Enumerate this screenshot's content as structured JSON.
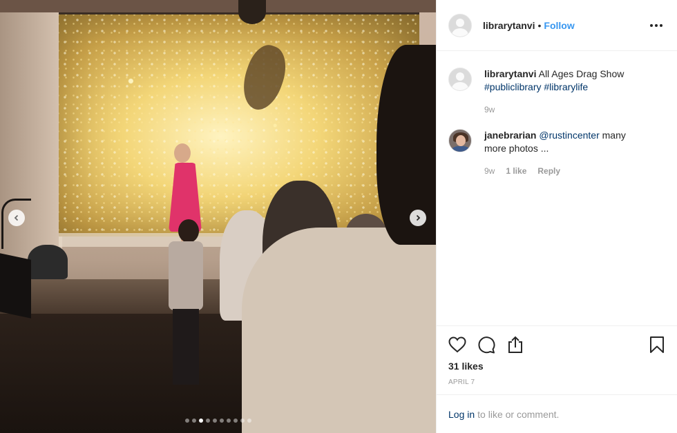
{
  "post": {
    "username": "librarytanvi",
    "separator": "•",
    "follow_label": "Follow",
    "caption": {
      "username": "librarytanvi",
      "text": "All Ages Drag Show",
      "tags": [
        "#publiclibrary",
        "#librarylife"
      ],
      "time": "9w"
    },
    "comments": [
      {
        "username": "janebrarian",
        "mention": "@rustincenter",
        "text": "many more photos ...",
        "time": "9w",
        "likes": "1 like",
        "reply_label": "Reply"
      }
    ],
    "likes_label": "31 likes",
    "date": "APRIL 7",
    "login": {
      "link": "Log in",
      "text": "to like or comment."
    }
  },
  "carousel": {
    "dot_count": 10,
    "active_index": 2
  },
  "icons": {
    "like": "heart-icon",
    "comment": "comment-icon",
    "share": "share-icon",
    "save": "bookmark-icon",
    "prev": "chevron-left-icon",
    "next": "chevron-right-icon",
    "more": "more-options-icon"
  },
  "colors": {
    "link": "#3897f0",
    "hashtag": "#003569",
    "muted": "#999999"
  }
}
